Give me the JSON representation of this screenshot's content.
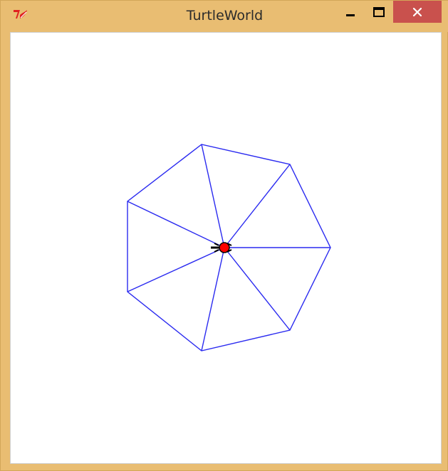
{
  "window": {
    "title": "TurtleWorld",
    "app_icon": "tk-feather-icon",
    "controls": {
      "minimize_icon": "minimize-icon",
      "maximize_icon": "maximize-icon",
      "close_icon": "close-icon"
    }
  },
  "canvas": {
    "background": "#ffffff",
    "line_color": "#2a2af0",
    "turtle_fill": "#ff0000",
    "turtle_outline": "#000000",
    "drawing": {
      "shape": "heptagon-with-spokes",
      "sides": 7
    }
  },
  "colors": {
    "window_chrome": "#e9bd72",
    "close_button": "#c9514d"
  }
}
